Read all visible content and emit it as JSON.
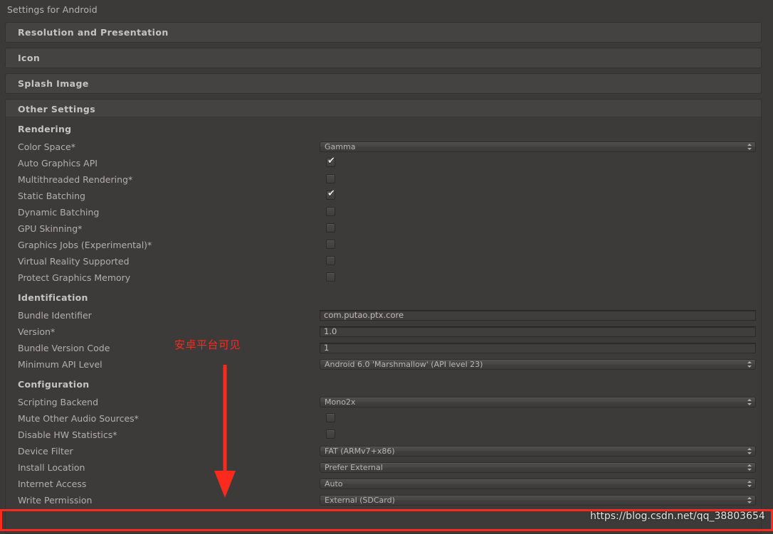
{
  "window": {
    "title": "Settings for Android"
  },
  "foldouts": [
    {
      "title": "Resolution and Presentation",
      "expanded": false
    },
    {
      "title": "Icon",
      "expanded": false
    },
    {
      "title": "Splash Image",
      "expanded": false
    },
    {
      "title": "Other Settings",
      "expanded": true
    }
  ],
  "other_settings": {
    "sections": [
      {
        "name": "Rendering",
        "rows": [
          {
            "label": "Color Space*",
            "type": "popup",
            "value": "Gamma"
          },
          {
            "label": "Auto Graphics API",
            "type": "checkbox",
            "checked": true
          },
          {
            "label": "Multithreaded Rendering*",
            "type": "checkbox",
            "checked": false
          },
          {
            "label": "Static Batching",
            "type": "checkbox",
            "checked": true
          },
          {
            "label": "Dynamic Batching",
            "type": "checkbox",
            "checked": false
          },
          {
            "label": "GPU Skinning*",
            "type": "checkbox",
            "checked": false
          },
          {
            "label": "Graphics Jobs (Experimental)*",
            "type": "checkbox",
            "checked": false
          },
          {
            "label": "Virtual Reality Supported",
            "type": "checkbox",
            "checked": false
          },
          {
            "label": "Protect Graphics Memory",
            "type": "checkbox",
            "checked": false
          }
        ]
      },
      {
        "name": "Identification",
        "rows": [
          {
            "label": "Bundle Identifier",
            "type": "text",
            "value": "com.putao.ptx.core"
          },
          {
            "label": "Version*",
            "type": "text",
            "value": "1.0"
          },
          {
            "label": "Bundle Version Code",
            "type": "text",
            "value": "1"
          },
          {
            "label": "Minimum API Level",
            "type": "popup",
            "value": "Android 6.0 'Marshmallow' (API level 23)"
          }
        ]
      },
      {
        "name": "Configuration",
        "rows": [
          {
            "label": "Scripting Backend",
            "type": "popup",
            "value": "Mono2x"
          },
          {
            "label": "Mute Other Audio Sources*",
            "type": "checkbox",
            "checked": false
          },
          {
            "label": "Disable HW Statistics*",
            "type": "checkbox",
            "checked": false
          },
          {
            "label": "Device Filter",
            "type": "popup",
            "value": "FAT (ARMv7+x86)"
          },
          {
            "label": "Install Location",
            "type": "popup",
            "value": "Prefer External"
          },
          {
            "label": "Internet Access",
            "type": "popup",
            "value": "Auto"
          },
          {
            "label": "Write Permission",
            "type": "popup",
            "value": "External (SDCard)"
          }
        ]
      }
    ]
  },
  "annotations": {
    "note_text": "安卓平台可见",
    "highlight_color": "#fb2a1c",
    "watermark": "https://blog.csdn.net/qq_38803654"
  },
  "icons": {
    "popup_arrow": "updown-arrow-icon",
    "checkmark": "✔",
    "annotation_arrow": "down-arrow-icon"
  }
}
